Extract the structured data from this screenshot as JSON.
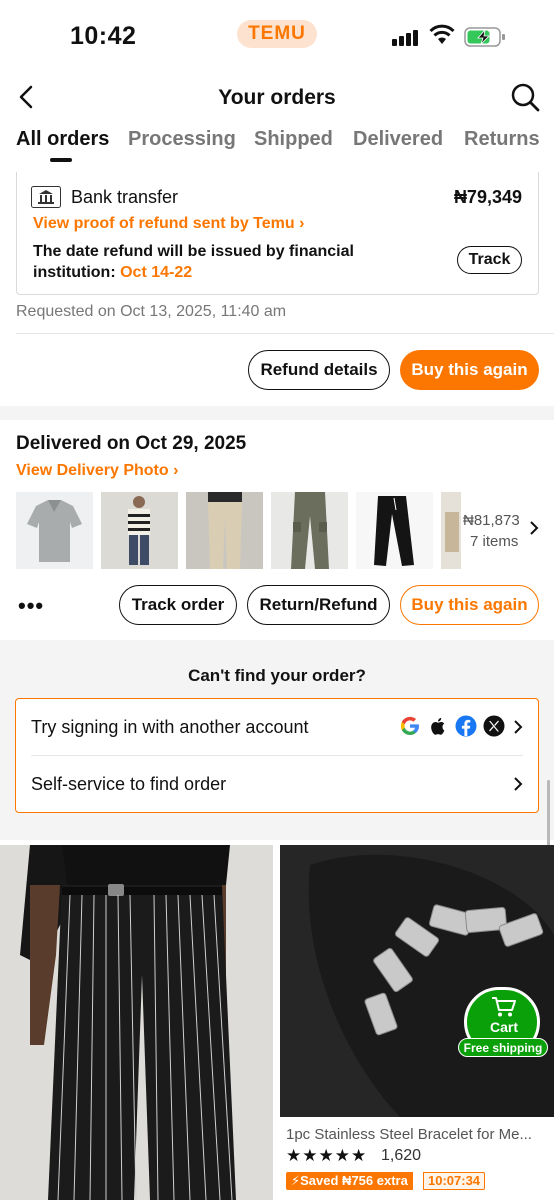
{
  "status_bar": {
    "time": "10:42",
    "app_badge": "TEMU"
  },
  "header": {
    "title": "Your orders"
  },
  "tabs": [
    {
      "label": "All orders",
      "active": true
    },
    {
      "label": "Processing"
    },
    {
      "label": "Shipped"
    },
    {
      "label": "Delivered"
    },
    {
      "label": "Returns"
    }
  ],
  "refund_order": {
    "payment_method": "Bank transfer",
    "amount": "₦79,349",
    "proof_link": "View proof of refund sent by Temu",
    "note_prefix": "The date refund will be issued by financial institution: ",
    "note_dates": "Oct 14-22",
    "track_label": "Track",
    "requested": "Requested on Oct 13, 2025, 11:40 am",
    "refund_details_label": "Refund details",
    "buy_again_label": "Buy this again"
  },
  "delivered_order": {
    "title": "Delivered on Oct 29, 2025",
    "delivery_photo_link": "View Delivery Photo",
    "total": "₦81,873",
    "item_count": "7 items",
    "more_label": "•••",
    "track_order_label": "Track order",
    "return_refund_label": "Return/Refund",
    "buy_again_label": "Buy this again"
  },
  "help": {
    "heading": "Can't find your order?",
    "sign_in_label": "Try signing in with another account",
    "self_service_label": "Self-service to find order"
  },
  "products": [
    {
      "image": "striped-trousers-photo"
    },
    {
      "image": "steel-bracelet-photo",
      "title": "1pc Stainless Steel Bracelet for Me...",
      "rating": "★★★★★",
      "reviews": "1,620",
      "saved": "Saved ₦756 extra",
      "timer": "10:07:34",
      "cart_label": "Cart",
      "free_shipping": "Free shipping"
    }
  ],
  "colors": {
    "accent": "#fb7701",
    "cart_green": "#0aa00a"
  }
}
